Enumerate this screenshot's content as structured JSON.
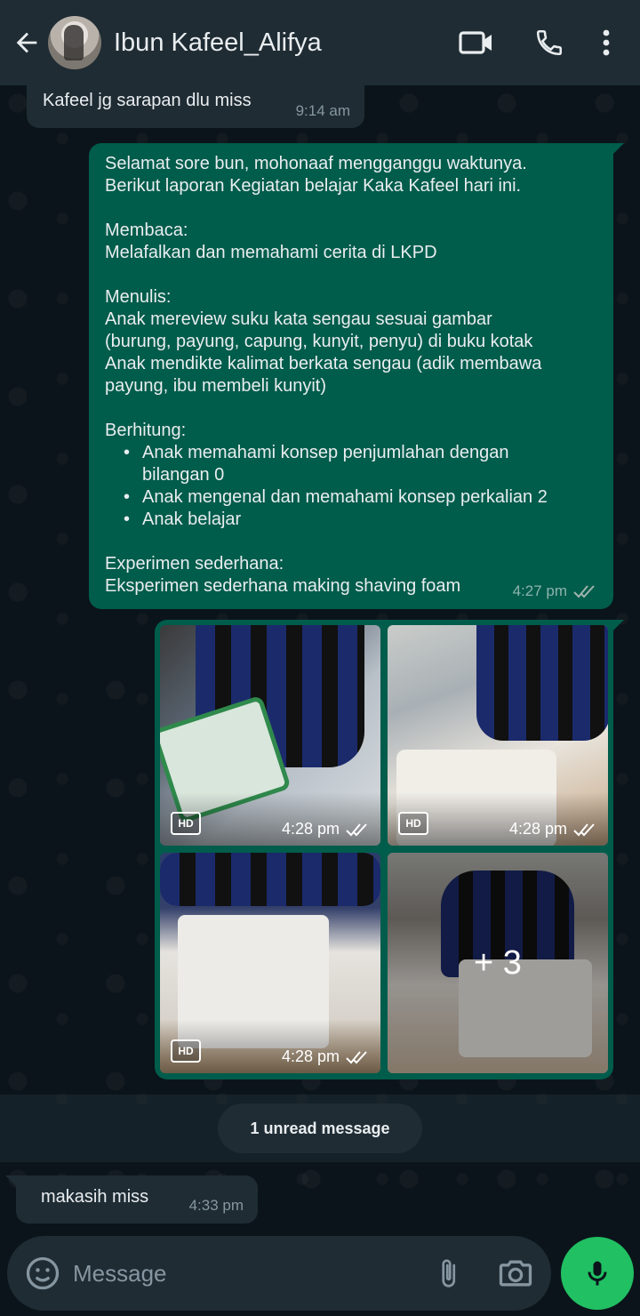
{
  "header": {
    "contact_name": "Ibun Kafeel_Alifya",
    "icons": [
      "back-arrow-icon",
      "video-call-icon",
      "voice-call-icon",
      "more-options-icon"
    ]
  },
  "messages": [
    {
      "direction": "incoming",
      "text": "Kafeel jg sarapan dlu miss",
      "time": "9:14 am"
    },
    {
      "direction": "outgoing",
      "lines": [
        "Selamat sore bun, mohonaaf mengganggu waktunya.",
        "Berikut laporan Kegiatan belajar Kaka Kafeel hari ini.",
        "",
        "Membaca:",
        "Melafalkan dan memahami cerita di LKPD",
        "",
        "Menulis:",
        "Anak mereview suku kata sengau sesuai gambar",
        "(burung, payung, capung, kunyit, penyu) di buku kotak",
        "Anak mendikte kalimat berkata sengau (adik membawa",
        "payung, ibu membeli kunyit)",
        "",
        "Berhitung:"
      ],
      "bullets": [
        [
          "Anak memahami konsep penjumlahan dengan",
          "bilangan 0"
        ],
        [
          "Anak mengenal dan memahami konsep perkalian 2"
        ],
        [
          "Anak belajar"
        ]
      ],
      "tail_lines": [
        "",
        "Experimen sederhana:",
        "Eksperimen sederhana making shaving foam"
      ],
      "time": "4:27 pm",
      "status": "read"
    },
    {
      "direction": "outgoing",
      "type": "media-album",
      "tiles": [
        {
          "hd": "HD",
          "time": "4:28 pm"
        },
        {
          "hd": "HD",
          "time": "4:28 pm"
        },
        {
          "hd": "HD",
          "time": "4:28 pm"
        },
        {
          "more": "+ 3"
        }
      ]
    },
    {
      "direction": "incoming",
      "text": "makasih miss",
      "time": "4:33 pm"
    }
  ],
  "unread_label": "1 unread message",
  "composer": {
    "placeholder": "Message"
  },
  "colors": {
    "header_bg": "#1f2c34",
    "chat_bg": "#0b141a",
    "outgoing_bubble": "#005c4b",
    "incoming_bubble": "#1f2c34",
    "mic_button": "#21c063",
    "read_ticks": "#8696a0"
  }
}
